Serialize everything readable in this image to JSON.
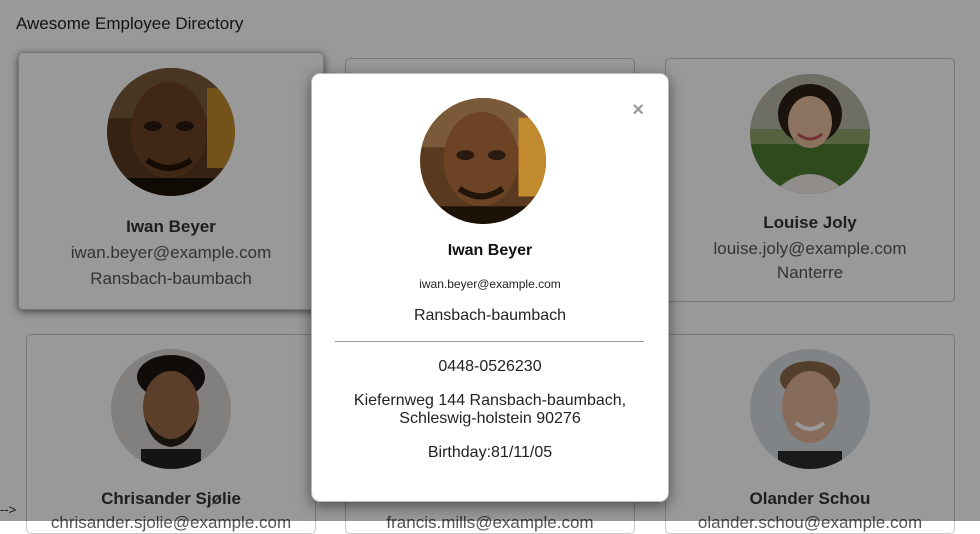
{
  "header": {
    "title": "Awesome Employee Directory"
  },
  "stray_text": "-->",
  "cards": [
    {
      "name": "Iwan Beyer",
      "email": "iwan.beyer@example.com",
      "city": "Ransbach-baumbach"
    },
    {
      "name": "",
      "email": "",
      "city": ""
    },
    {
      "name": "Louise Joly",
      "email": "louise.joly@example.com",
      "city": "Nanterre"
    },
    {
      "name": "Chrisander Sjølie",
      "email": "chrisander.sjolie@example.com",
      "city": ""
    },
    {
      "name": "",
      "email": "francis.mills@example.com",
      "city": ""
    },
    {
      "name": "Olander Schou",
      "email": "olander.schou@example.com",
      "city": ""
    }
  ],
  "modal": {
    "close": "×",
    "name": "Iwan Beyer",
    "email": "iwan.beyer@example.com",
    "city": "Ransbach-baumbach",
    "phone": "0448-0526230",
    "address": "Kiefernweg 144 Ransbach-baumbach, Schleswig-holstein 90276",
    "birthday": "Birthday:81/11/05"
  },
  "colors": {
    "overlay": "rgba(0,0,0,0.40)",
    "card_border": "#c9c9c9"
  }
}
